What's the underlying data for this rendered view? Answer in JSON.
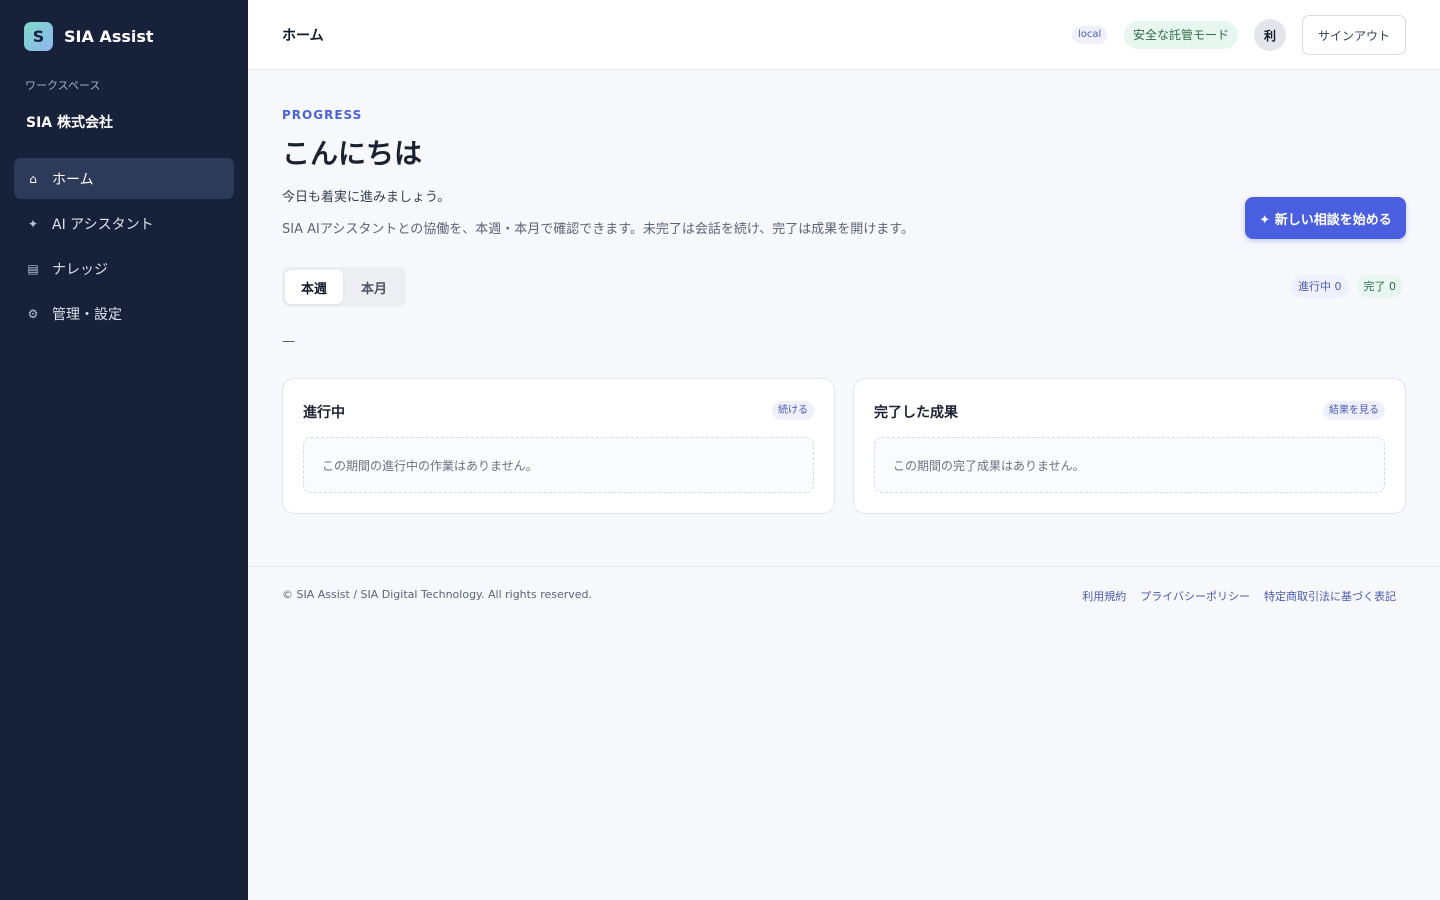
{
  "brand": {
    "logo_letter": "S",
    "name": "SIA Assist"
  },
  "workspace": {
    "label": "ワークスペース",
    "name": "SIA 株式会社"
  },
  "sidebar": {
    "items": [
      {
        "label": "ホーム",
        "icon": "home-icon",
        "glyph": "⌂",
        "active": true
      },
      {
        "label": "AI アシスタント",
        "icon": "sparkle-icon",
        "glyph": "✦",
        "active": false
      },
      {
        "label": "ナレッジ",
        "icon": "document-icon",
        "glyph": "▤",
        "active": false
      },
      {
        "label": "管理・設定",
        "icon": "gear-icon",
        "glyph": "⚙",
        "active": false
      }
    ]
  },
  "header": {
    "title": "ホーム",
    "env_badge": "local",
    "mode_badge": "安全な託管モード",
    "avatar_text": "利",
    "signout_label": "サインアウト"
  },
  "main": {
    "eyebrow": "PROGRESS",
    "greeting": "こんにちは",
    "subtitle": "今日も着実に進みましょう。",
    "description": "SIA AIアシスタントとの協働を、本週・本月で確認できます。未完了は会話を続け、完了は成果を開けます。",
    "new_button": "✦ 新しい相談を始める",
    "tabs": [
      {
        "label": "本週",
        "active": true
      },
      {
        "label": "本月",
        "active": false
      }
    ],
    "badges": {
      "in_progress": "進行中 0",
      "done": "完了 0"
    },
    "period_placeholder": "—",
    "cards": {
      "in_progress": {
        "title": "進行中",
        "action": "続ける",
        "empty": "この期間の進行中の作業はありません。"
      },
      "done": {
        "title": "完了した成果",
        "action": "結果を見る",
        "empty": "この期間の完了成果はありません。"
      }
    }
  },
  "footer": {
    "copyright": "© SIA Assist / SIA Digital Technology. All rights reserved.",
    "links": [
      "利用規約",
      "プライバシーポリシー",
      "特定商取引法に基づく表記"
    ]
  },
  "colors": {
    "sidebar_bg": "#18213a",
    "accent": "#4a5fe0",
    "success": "#2f6b4c"
  }
}
